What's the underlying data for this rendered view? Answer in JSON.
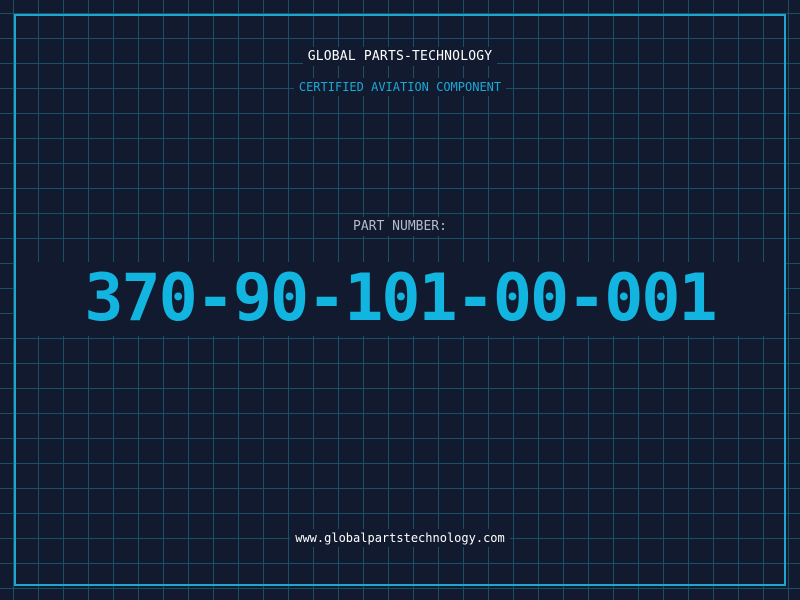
{
  "header": {
    "company_name": "GLOBAL PARTS-TECHNOLOGY",
    "subtitle": "CERTIFIED AVIATION COMPONENT"
  },
  "part": {
    "label": "PART NUMBER:",
    "number": "370-90-101-00-001"
  },
  "footer": {
    "website": "www.globalpartstechnology.com"
  },
  "colors": {
    "background": "#111a2e",
    "grid": "#1b4f66",
    "accent": "#1ea6cf",
    "part_number": "#12b4e0",
    "label": "#b3bccb",
    "heading": "#ffffff"
  }
}
